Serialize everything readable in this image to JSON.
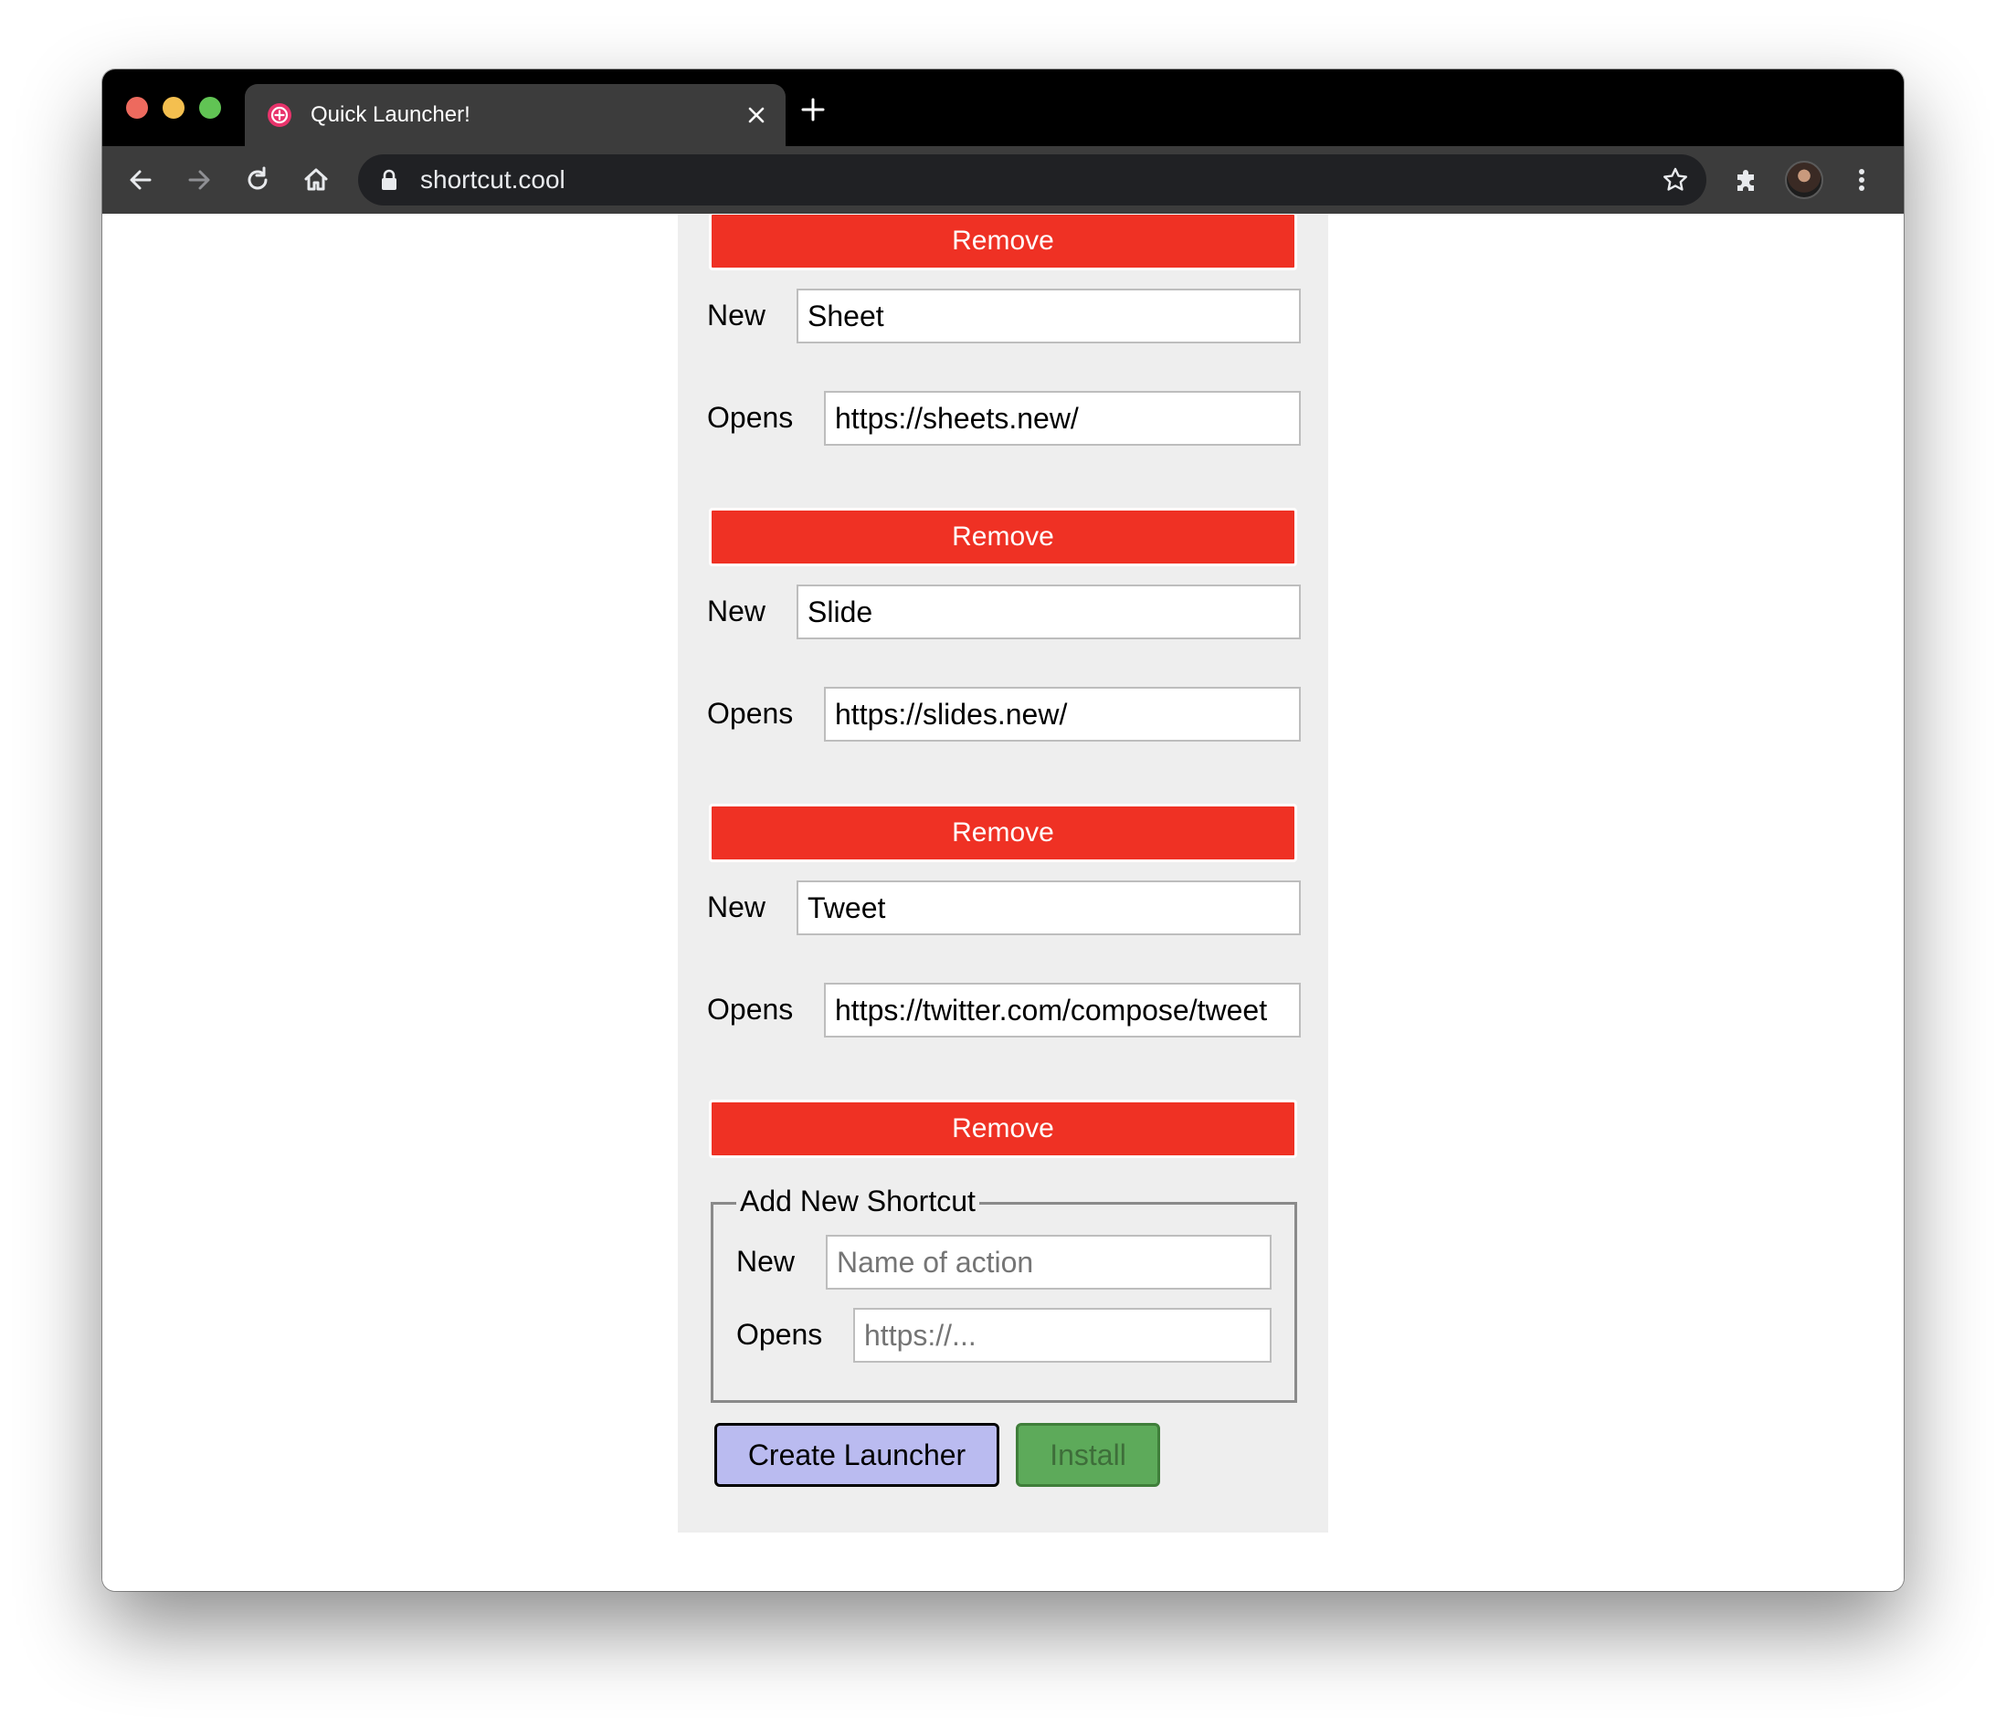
{
  "browser": {
    "tab_title": "Quick Launcher!",
    "url": "shortcut.cool"
  },
  "shortcuts": [
    {
      "remove_label": "Remove"
    },
    {
      "new_label": "New",
      "name": "Sheet",
      "opens_label": "Opens",
      "url": "https://sheets.new/",
      "remove_label": "Remove"
    },
    {
      "new_label": "New",
      "name": "Slide",
      "opens_label": "Opens",
      "url": "https://slides.new/",
      "remove_label": "Remove"
    },
    {
      "new_label": "New",
      "name": "Tweet",
      "opens_label": "Opens",
      "url": "https://twitter.com/compose/tweet",
      "remove_label": "Remove"
    }
  ],
  "add_new": {
    "legend": "Add New Shortcut",
    "new_label": "New",
    "name_placeholder": "Name of action",
    "opens_label": "Opens",
    "url_placeholder": "https://..."
  },
  "actions": {
    "create_label": "Create Launcher",
    "install_label": "Install"
  },
  "colors": {
    "remove": "#ef3124",
    "create": "#babbf0",
    "install": "#5daa5a",
    "panel": "#eeeeee"
  }
}
